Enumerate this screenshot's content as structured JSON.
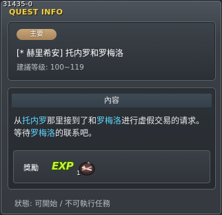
{
  "window": {
    "quest_id": "31435-0",
    "title": "QUEST INFO"
  },
  "quest": {
    "category_badge": "主要",
    "name": "[* 赫里希安] 托内罗和罗梅洛",
    "level": "建議等级: 100~119"
  },
  "content": {
    "header": "內容",
    "desc_1": "从",
    "desc_2": "托内罗",
    "desc_3": "那里接到了和",
    "desc_4": "罗梅洛",
    "desc_5": "进行虚假交易的请求。等待",
    "desc_6": "罗梅洛",
    "desc_7": "的联系吧。",
    "highlight_color": "#5fd6ff"
  },
  "reward": {
    "label": "獎勵",
    "exp_label": "EXP",
    "item_icon": "dark-orb-bag-icon",
    "item_count": "1"
  },
  "status": {
    "text": "狀態: 可開始 / 不可執行任務"
  }
}
